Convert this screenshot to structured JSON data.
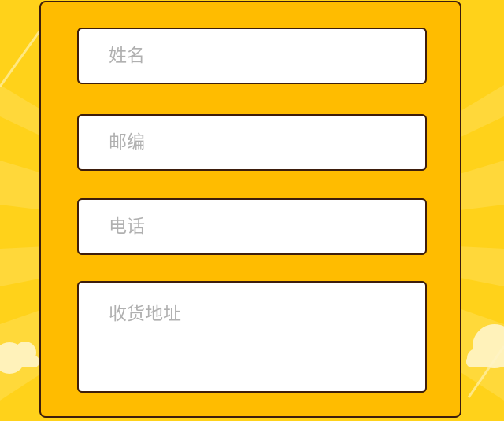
{
  "form": {
    "fields": [
      {
        "placeholder": "姓名",
        "value": ""
      },
      {
        "placeholder": "邮编",
        "value": ""
      },
      {
        "placeholder": "电话",
        "value": ""
      },
      {
        "placeholder": "收货地址",
        "value": ""
      }
    ]
  },
  "colors": {
    "background": "#ffd21a",
    "card": "#ffbc00",
    "border": "#3d1d0c",
    "placeholder": "#b0b0b0"
  }
}
